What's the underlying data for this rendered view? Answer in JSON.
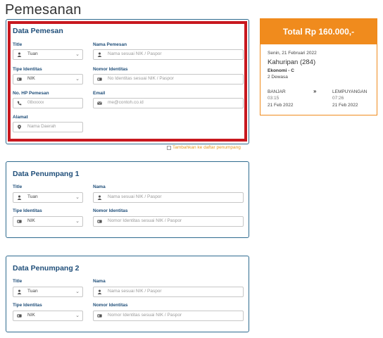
{
  "page": {
    "title": "Pemesanan"
  },
  "pemesan": {
    "title": "Data Pemesan",
    "title_label": "Title",
    "title_value": "Tuan",
    "name_label": "Nama Pemesan",
    "name_placeholder": "Nama sesuai NIK / Paspor",
    "id_type_label": "Tipe Identitas",
    "id_type_value": "NIK",
    "id_number_label": "Nomor Identitas",
    "id_number_placeholder": "No Identitas sesuai NIK / Paspor",
    "phone_label": "No. HP Pemesan",
    "phone_placeholder": "08xxxxx",
    "email_label": "Email",
    "email_placeholder": "me@contoh.co.id",
    "address_label": "Alamat",
    "address_placeholder": "Nama Daerah",
    "add_passenger_label": "Tambahkan ke daftar penumpang"
  },
  "passengers": [
    {
      "title": "Data Penumpang 1",
      "title_label": "Title",
      "title_value": "Tuan",
      "name_label": "Nama",
      "name_placeholder": "Nama sesuai NIK / Paspor",
      "id_type_label": "Tipe Identitas",
      "id_type_value": "NIK",
      "id_number_label": "Nomor Identitas",
      "id_number_placeholder": "Nomor Identitas sesuai NIK / Paspor"
    },
    {
      "title": "Data Penumpang 2",
      "title_label": "Title",
      "title_value": "Tuan",
      "name_label": "Nama",
      "name_placeholder": "Nama sesuai NIK / Paspor",
      "id_type_label": "Tipe Identitas",
      "id_type_value": "NIK",
      "id_number_label": "Nomor Identitas",
      "id_number_placeholder": "Nomor Identitas sesuai NIK / Paspor"
    }
  ],
  "summary": {
    "total": "Total Rp 160.000,-",
    "date": "Senin, 21 Februari 2022",
    "train": "Kahuripan (284)",
    "class": "Ekonomi - C",
    "passengers": "2 Dewasa",
    "arrow": "»",
    "origin": {
      "station": "BANJAR",
      "time": "03:15",
      "date": "21 Feb 2022"
    },
    "destination": {
      "station": "LEMPUYANGAN",
      "time": "07:26",
      "date": "21 Feb 2022"
    }
  },
  "colors": {
    "accent": "#f08b1d",
    "heading": "#1f4e79",
    "highlight": "#c8181f",
    "card_border": "#2f6b8f"
  },
  "icons": [
    "user-icon",
    "id-card-icon",
    "phone-icon",
    "envelope-icon",
    "map-pin-icon",
    "chevron-down-icon"
  ]
}
